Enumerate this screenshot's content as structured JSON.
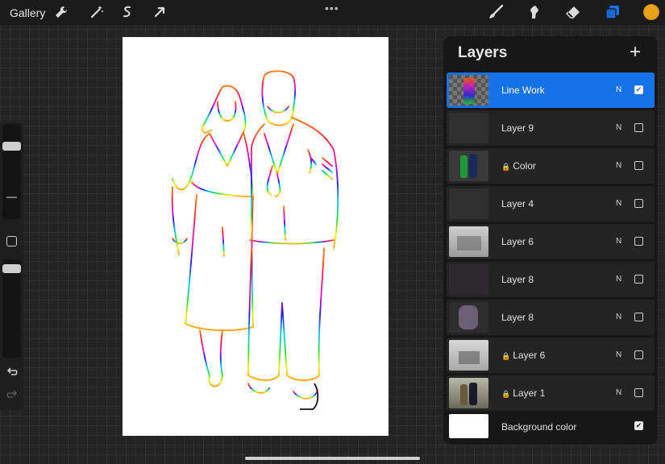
{
  "topbar": {
    "gallery_label": "Gallery",
    "left_tools": [
      "wrench-icon",
      "magic-wand-icon",
      "selection-icon",
      "transform-arrow-icon"
    ],
    "more_label": "•••",
    "right_tools": [
      "brush-icon",
      "smudge-icon",
      "eraser-icon",
      "layers-icon"
    ],
    "current_color": "#e9a31b"
  },
  "sidebar": {
    "controls": [
      "brush-size-slider",
      "modify-button",
      "opacity-slider",
      "undo-icon",
      "redo-icon"
    ]
  },
  "layers": {
    "title": "Layers",
    "add_label": "+",
    "accent": "#1572e8",
    "items": [
      {
        "name": "Line Work",
        "mode": "N",
        "visible": true,
        "locked": false,
        "active": true
      },
      {
        "name": "Layer 9",
        "mode": "N",
        "visible": false,
        "locked": false,
        "active": false
      },
      {
        "name": "Color",
        "mode": "N",
        "visible": false,
        "locked": true,
        "active": false
      },
      {
        "name": "Layer 4",
        "mode": "N",
        "visible": false,
        "locked": false,
        "active": false
      },
      {
        "name": "Layer 6",
        "mode": "N",
        "visible": false,
        "locked": false,
        "active": false
      },
      {
        "name": "Layer 8",
        "mode": "N",
        "visible": false,
        "locked": false,
        "active": false
      },
      {
        "name": "Layer 8",
        "mode": "N",
        "visible": false,
        "locked": false,
        "active": false
      },
      {
        "name": "Layer 6",
        "mode": "N",
        "visible": false,
        "locked": true,
        "active": false
      },
      {
        "name": "Layer 1",
        "mode": "N",
        "visible": false,
        "locked": true,
        "active": false
      }
    ],
    "background": {
      "name": "Background color",
      "visible": true,
      "color": "#ffffff"
    }
  }
}
